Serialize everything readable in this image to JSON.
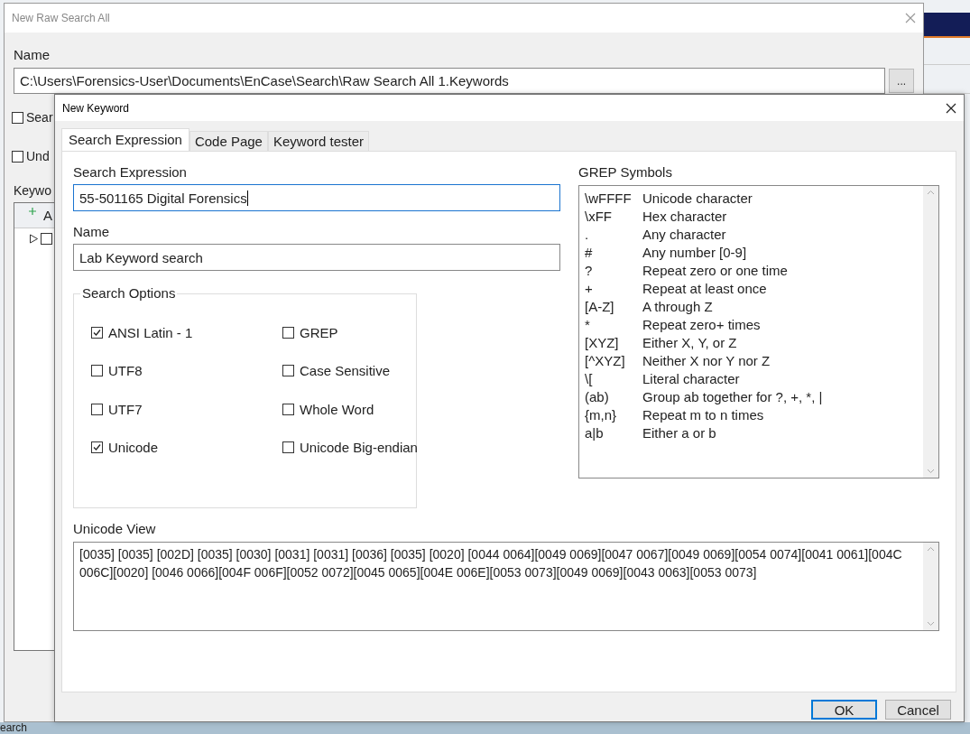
{
  "background": {
    "status_text": "earch"
  },
  "outer_dialog": {
    "title": "New Raw Search All",
    "name_label": "Name",
    "name_value": "C:\\Users\\Forensics-User\\Documents\\EnCase\\Search\\Raw Search All 1.Keywords",
    "browse_button": "...",
    "options": [
      {
        "label": "Sear",
        "checked": false
      },
      {
        "label": "Und",
        "checked": false
      }
    ],
    "keywords_label": "Keywo",
    "table_header": "A",
    "tree_rows": [
      {
        "expanded": false,
        "checked": false
      }
    ]
  },
  "inner_dialog": {
    "title": "New Keyword",
    "tabs": [
      {
        "label": "Search Expression",
        "selected": true
      },
      {
        "label": "Code Page",
        "selected": false
      },
      {
        "label": "Keyword tester",
        "selected": false
      }
    ],
    "search_expression": {
      "label": "Search Expression",
      "value": "55-501165 Digital Forensics"
    },
    "name": {
      "label": "Name",
      "value": "Lab Keyword search"
    },
    "search_options": {
      "title": "Search Options",
      "options": [
        {
          "label": "ANSI Latin - 1",
          "checked": true
        },
        {
          "label": "GREP",
          "checked": false
        },
        {
          "label": "UTF8",
          "checked": false
        },
        {
          "label": "Case Sensitive",
          "checked": false
        },
        {
          "label": "UTF7",
          "checked": false
        },
        {
          "label": "Whole Word",
          "checked": false
        },
        {
          "label": "Unicode",
          "checked": true
        },
        {
          "label": "Unicode Big-endian",
          "checked": false
        }
      ]
    },
    "grep_symbols": {
      "title": "GREP Symbols",
      "rows": [
        {
          "symbol": "\\wFFFF",
          "description": "Unicode character"
        },
        {
          "symbol": "\\xFF",
          "description": "Hex character"
        },
        {
          "symbol": ".",
          "description": "Any character"
        },
        {
          "symbol": "#",
          "description": "Any number [0-9]"
        },
        {
          "symbol": "?",
          "description": "Repeat zero or one time"
        },
        {
          "symbol": "+",
          "description": "Repeat at least once"
        },
        {
          "symbol": "[A-Z]",
          "description": "A through Z"
        },
        {
          "symbol": "*",
          "description": "Repeat zero+ times"
        },
        {
          "symbol": "[XYZ]",
          "description": "Either X, Y, or Z"
        },
        {
          "symbol": "[^XYZ]",
          "description": "Neither X nor Y nor Z"
        },
        {
          "symbol": "\\[",
          "description": "Literal character"
        },
        {
          "symbol": "(ab)",
          "description": "Group ab together for ?, +, *, |"
        },
        {
          "symbol": "{m,n}",
          "description": "Repeat m to n times"
        },
        {
          "symbol": "a|b",
          "description": "Either a or b"
        }
      ]
    },
    "unicode_view": {
      "label": "Unicode View",
      "value": "[0035] [0035] [002D] [0035] [0030] [0031] [0031] [0036] [0035] [0020] [0044 0064][0049 0069][0047 0067][0049 0069][0054 0074][0041 0061][004C 006C][0020] [0046 0066][004F 006F][0052 0072][0045 0065][004E 006E][0053 0073][0049 0069][0043 0063][0053 0073]"
    },
    "buttons": [
      {
        "label": "OK",
        "default": true
      },
      {
        "label": "Cancel",
        "default": false
      }
    ]
  }
}
